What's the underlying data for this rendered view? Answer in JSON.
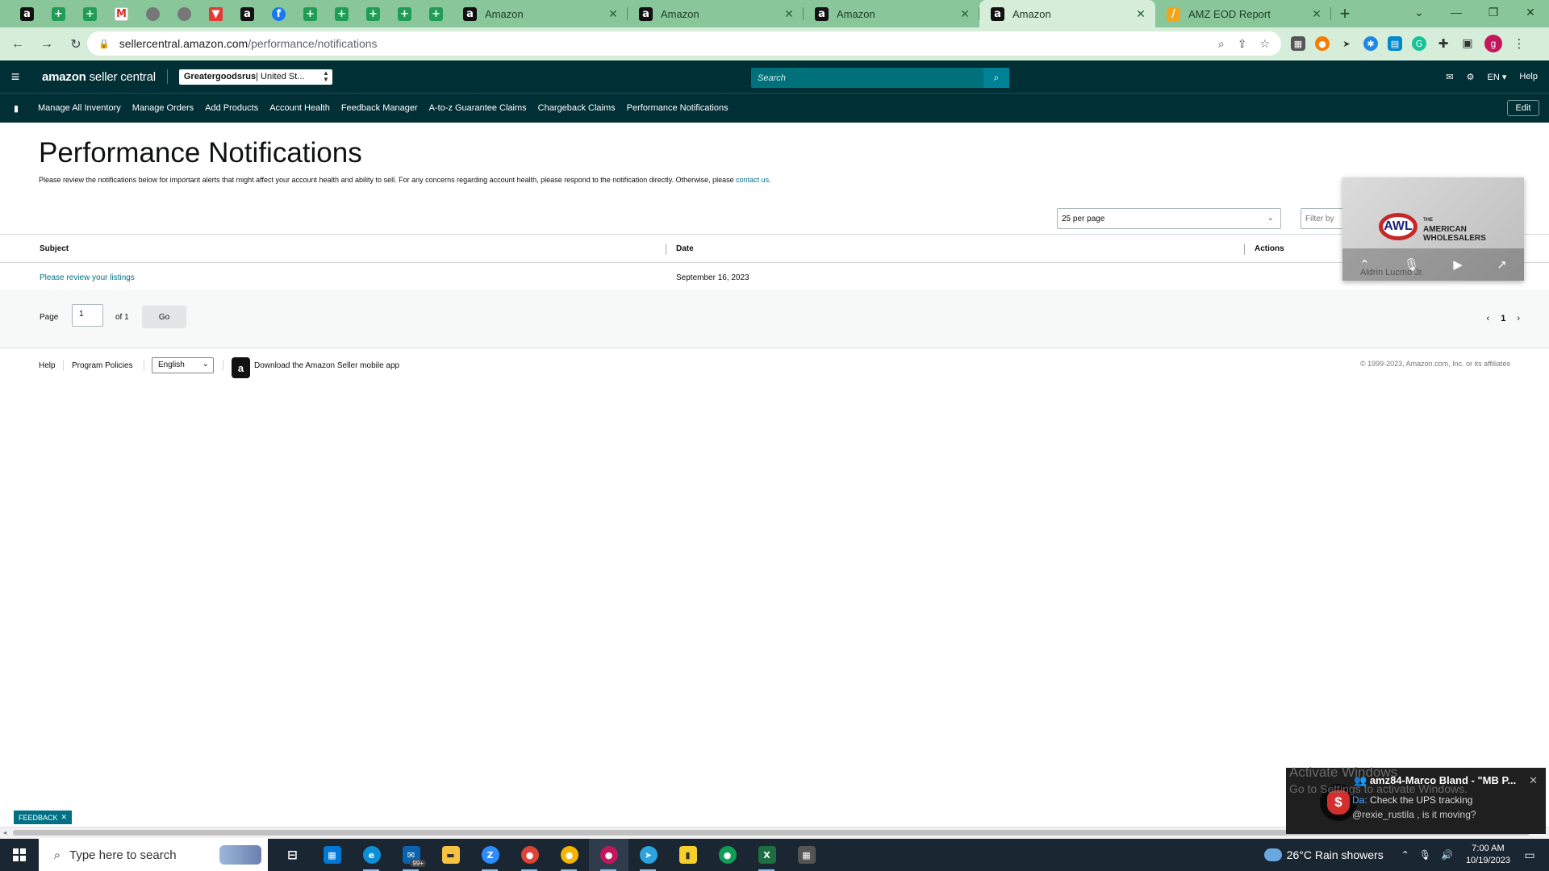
{
  "browser": {
    "pinned_tabs": [
      {
        "icon": "amazon-a-icon",
        "glyph": "a",
        "class": "fi-a"
      },
      {
        "icon": "sheets-plus-icon",
        "glyph": "+",
        "class": "fi-plus"
      },
      {
        "icon": "sheets-plus-icon",
        "glyph": "+",
        "class": "fi-plus"
      },
      {
        "icon": "gmail-icon",
        "glyph": "M",
        "class": "fi-m"
      },
      {
        "icon": "globe-icon",
        "glyph": "",
        "class": "fi-glob"
      },
      {
        "icon": "globe-icon",
        "glyph": "",
        "class": "fi-glob"
      },
      {
        "icon": "vpn-icon",
        "glyph": "▼",
        "class": "fi-v"
      },
      {
        "icon": "amazon-a-icon",
        "glyph": "a",
        "class": "fi-a"
      },
      {
        "icon": "facebook-icon",
        "glyph": "f",
        "class": "fi-f"
      },
      {
        "icon": "sheets-plus-icon",
        "glyph": "+",
        "class": "fi-plus"
      },
      {
        "icon": "sheets-plus-icon",
        "glyph": "+",
        "class": "fi-plus"
      },
      {
        "icon": "sheets-plus-icon",
        "glyph": "+",
        "class": "fi-plus"
      },
      {
        "icon": "sheets-plus-icon",
        "glyph": "+",
        "class": "fi-plus"
      },
      {
        "icon": "sheets-plus-icon",
        "glyph": "+",
        "class": "fi-plus"
      }
    ],
    "tabs": [
      {
        "label": "Amazon",
        "icon": "amazon-a-icon",
        "active": false
      },
      {
        "label": "Amazon",
        "icon": "amazon-a-icon",
        "active": false
      },
      {
        "label": "Amazon",
        "icon": "amazon-a-icon",
        "active": false
      },
      {
        "label": "Amazon",
        "icon": "amazon-a-icon",
        "active": true
      },
      {
        "label": "AMZ EOD Report",
        "icon": "amz-report-icon",
        "active": false
      }
    ],
    "url_host": "sellercentral.amazon.com",
    "url_path": "/performance/notifications",
    "profile_initial": "g"
  },
  "header": {
    "logo_bold": "amazon",
    "logo_rest": " seller central",
    "store_name": "Greatergoodsrus",
    "store_region": " | United St...",
    "search_placeholder": "Search",
    "lang": "EN",
    "help": "Help"
  },
  "nav": {
    "links": [
      "Manage All Inventory",
      "Manage Orders",
      "Add Products",
      "Account Health",
      "Feedback Manager",
      "A-to-z Guarantee Claims",
      "Chargeback Claims",
      "Performance Notifications"
    ],
    "edit": "Edit"
  },
  "main": {
    "title": "Performance Notifications",
    "description": "Please review the notifications below for important alerts that might affect your account health and ability to sell. For any concerns regarding account health, please respond to the notification directly. Otherwise, please ",
    "contact_link": "contact us",
    "per_page": "25 per page",
    "filter_placeholder": "Filter by",
    "columns": {
      "subject": "Subject",
      "date": "Date",
      "actions": "Actions"
    },
    "rows": [
      {
        "subject": "Please review your listings",
        "date": "September 16, 2023"
      }
    ],
    "pager": {
      "label": "Page",
      "value": "1",
      "of": "of 1",
      "go": "Go",
      "current": "1"
    }
  },
  "footer": {
    "help": "Help",
    "policies": "Program Policies",
    "language": "English",
    "app": "Download the Amazon Seller mobile app",
    "copyright": "© 1999-2023, Amazon.com, Inc. or its affiliates"
  },
  "video": {
    "brand_line1": "THE",
    "brand_line2": "AMERICAN",
    "brand_line3": "WHOLESALERS",
    "participant": "Aldrin Lucmo Jr."
  },
  "feedback": "FEEDBACK",
  "activate": {
    "line1": "Activate Windows",
    "line2": "Go to Settings to activate Windows."
  },
  "toast": {
    "title": "amz84-Marco Bland - \"MB P...",
    "msg1_sender": "Da:",
    "msg1": " Check the UPS tracking",
    "msg2": "@rexie_rustila , is it moving?"
  },
  "taskbar": {
    "search_placeholder": "Type here to search",
    "mail_badge": "99+",
    "weather": "26°C  Rain showers",
    "time": "7:00 AM",
    "date": "10/19/2023"
  }
}
